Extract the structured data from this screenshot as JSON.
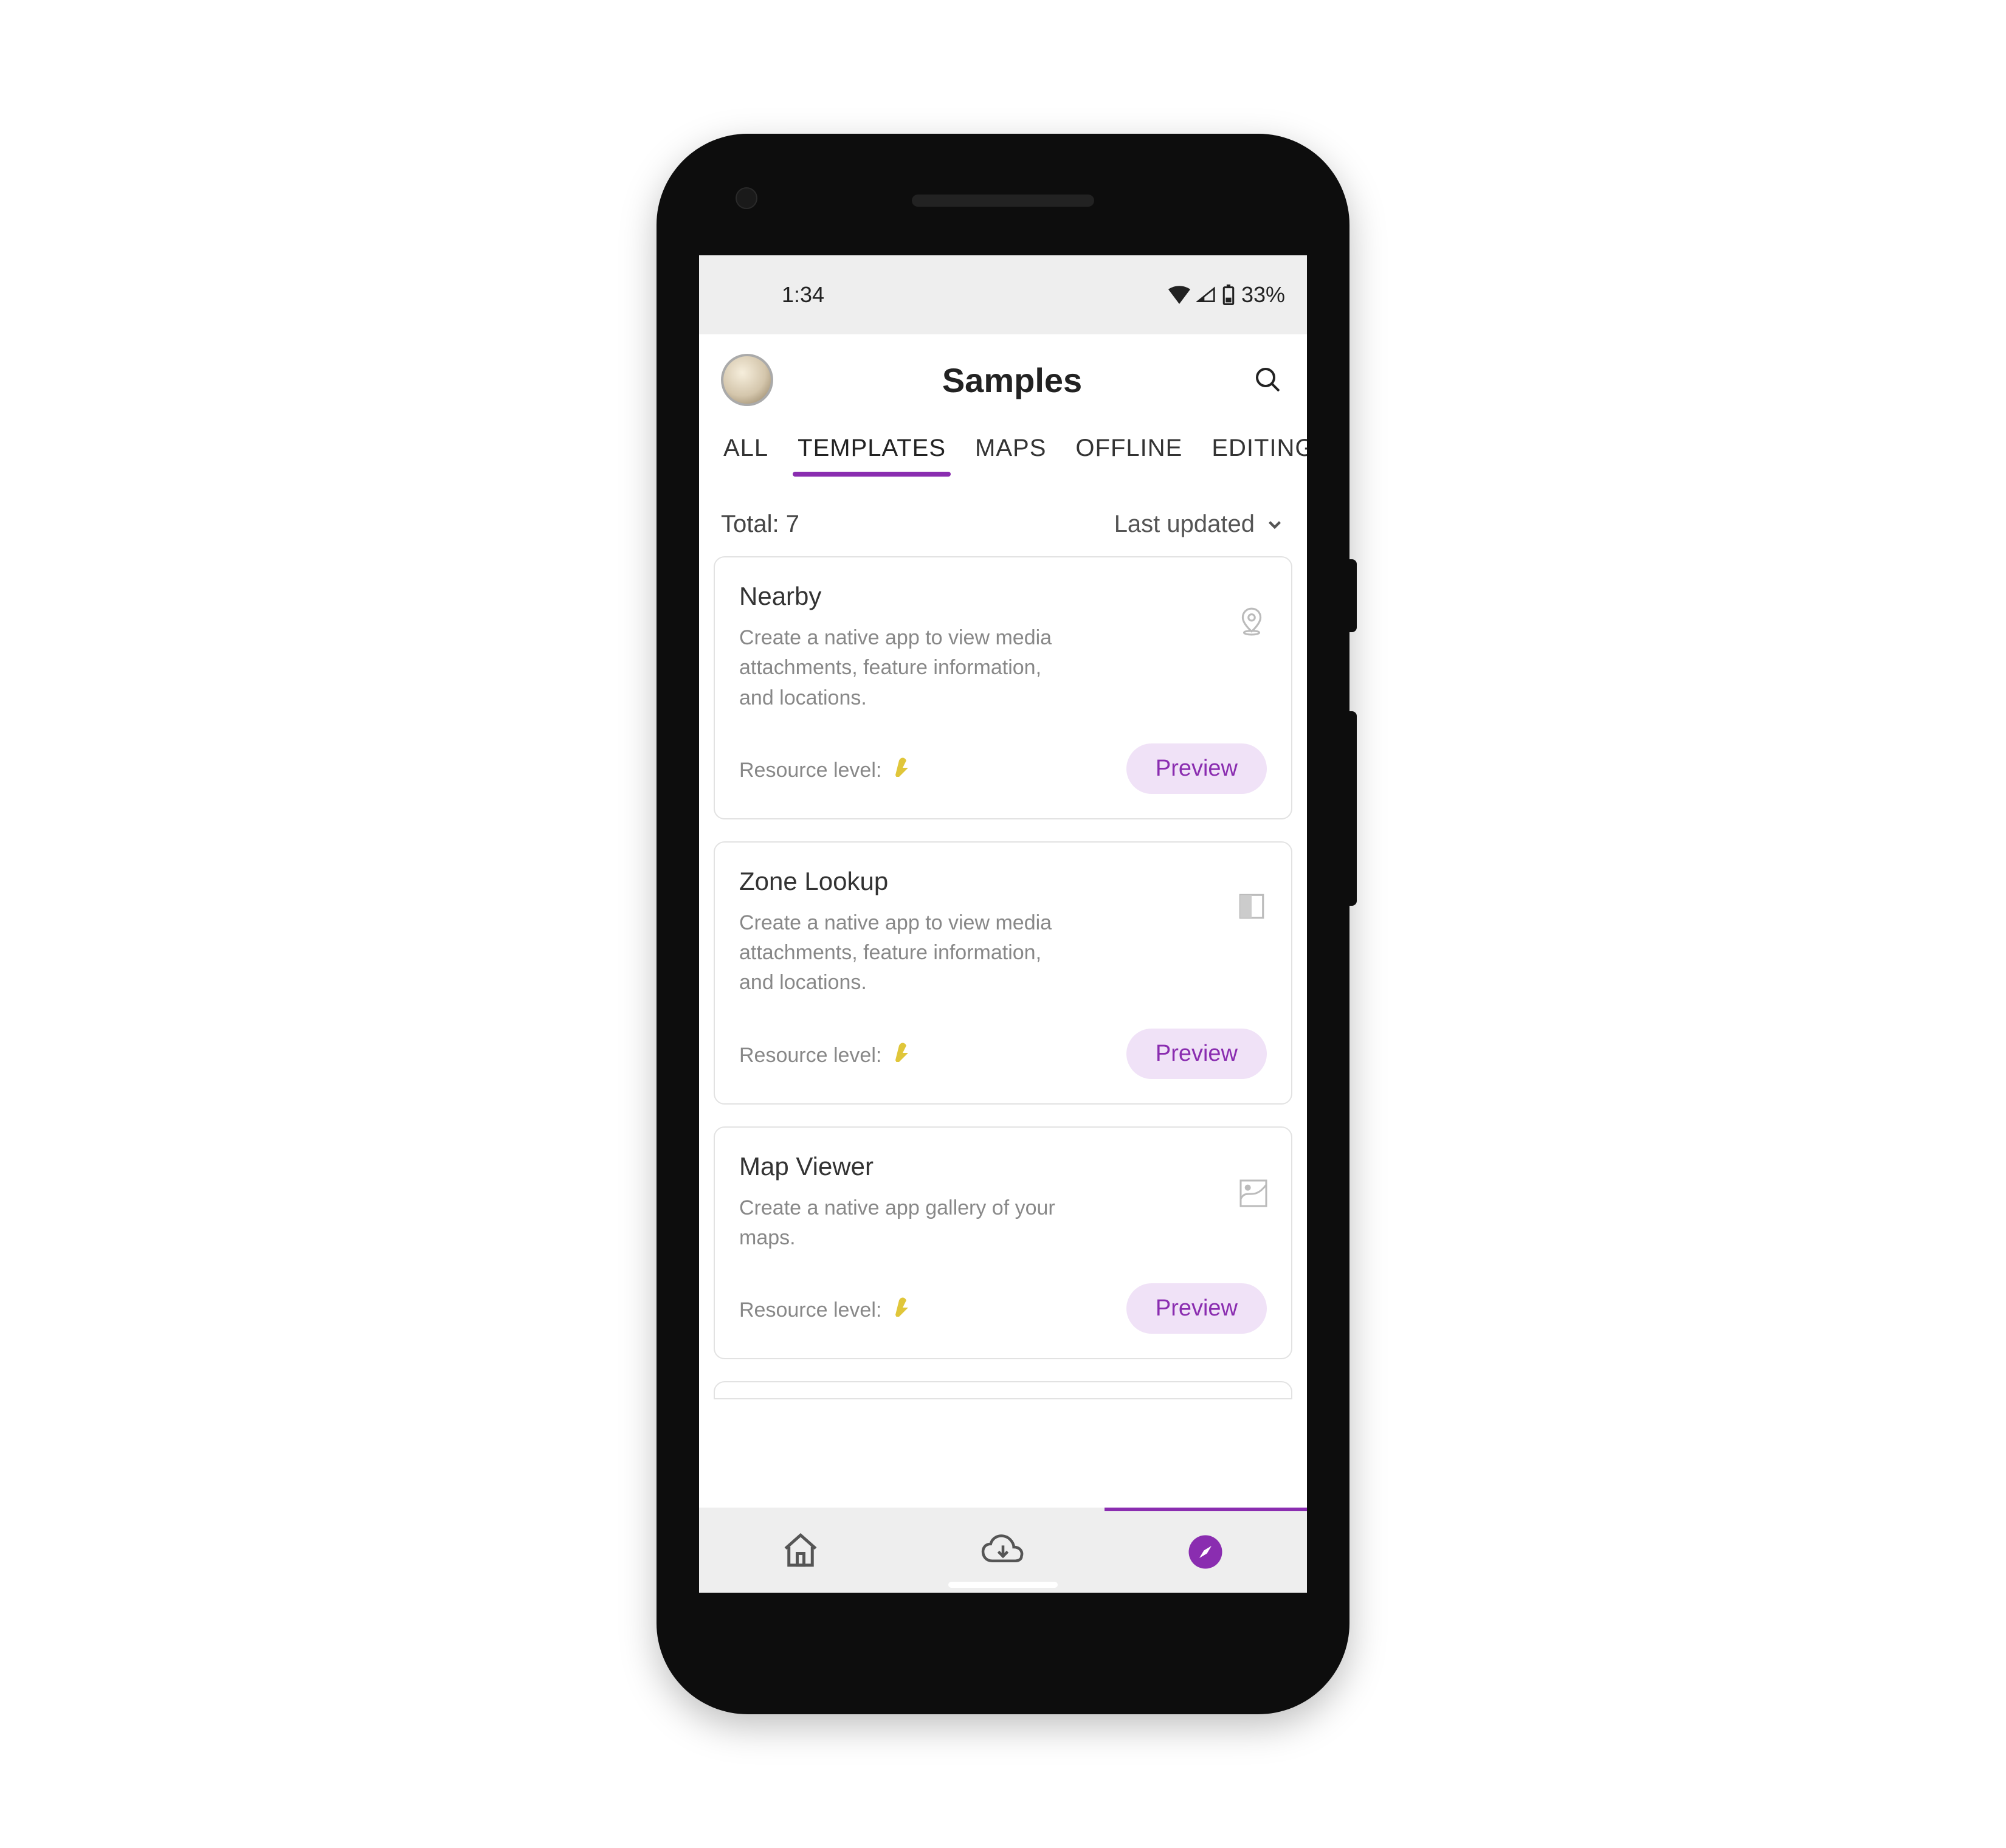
{
  "status": {
    "time": "1:34",
    "battery_text": "33%"
  },
  "header": {
    "title": "Samples"
  },
  "tabs": [
    {
      "label": "ALL",
      "active": false
    },
    {
      "label": "TEMPLATES",
      "active": true
    },
    {
      "label": "MAPS",
      "active": false
    },
    {
      "label": "OFFLINE",
      "active": false
    },
    {
      "label": "EDITING",
      "active": false
    }
  ],
  "summary": {
    "total_label": "Total:",
    "total_count": "7",
    "sort_label": "Last updated"
  },
  "cards": [
    {
      "title": "Nearby",
      "desc": "Create a native app to view media attachments, feature information, and locations.",
      "resource_label": "Resource level:",
      "preview_label": "Preview"
    },
    {
      "title": "Zone Lookup",
      "desc": "Create a native app to view media attachments, feature information, and locations.",
      "resource_label": "Resource level:",
      "preview_label": "Preview"
    },
    {
      "title": "Map Viewer",
      "desc": "Create a native app gallery of your maps.",
      "resource_label": "Resource level:",
      "preview_label": "Preview"
    }
  ],
  "accent_color": "#8a2db0"
}
